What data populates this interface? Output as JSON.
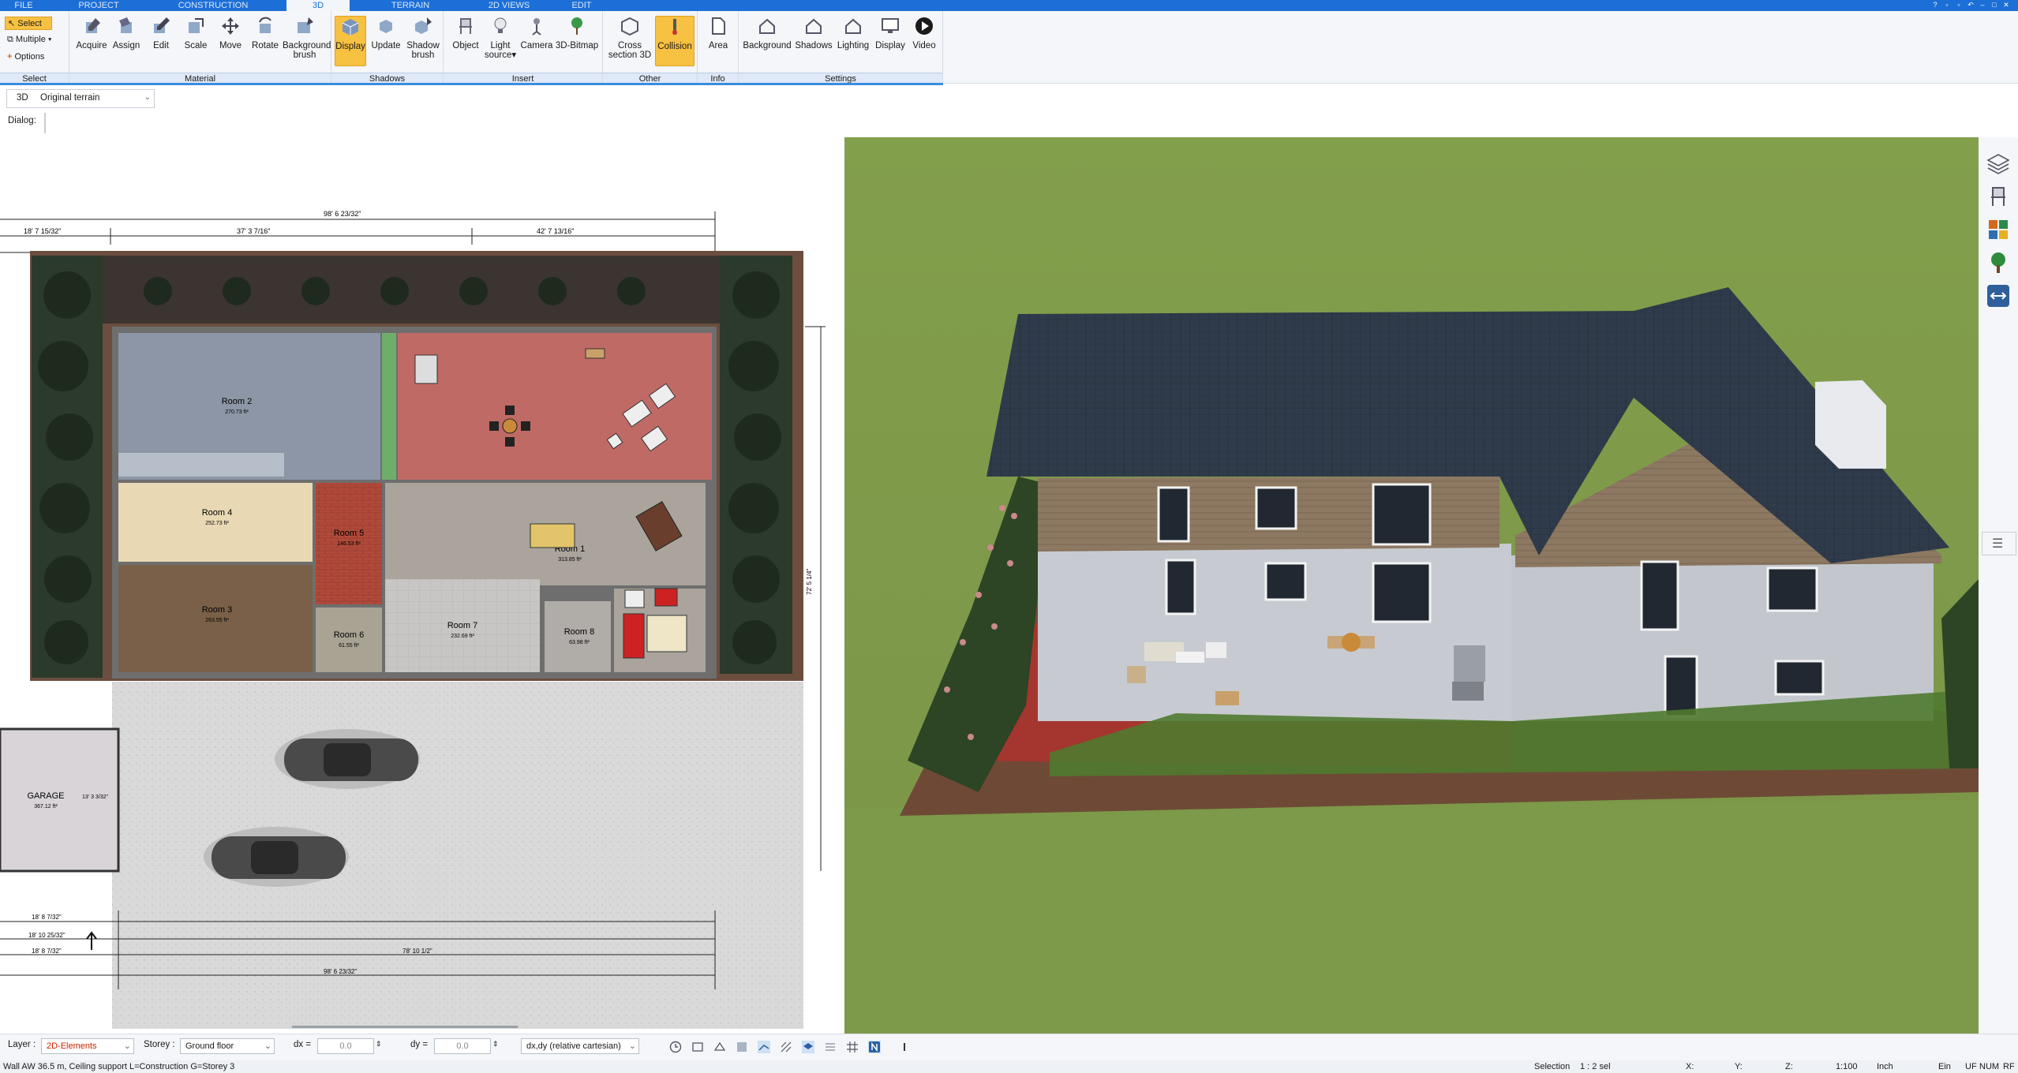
{
  "menu": {
    "tabs": [
      {
        "label": "FILE"
      },
      {
        "label": "PROJECT"
      },
      {
        "label": "CONSTRUCTION"
      },
      {
        "label": "3D"
      },
      {
        "label": "TERRAIN"
      },
      {
        "label": "2D VIEWS"
      },
      {
        "label": "EDIT"
      }
    ],
    "active": "3D"
  },
  "ribbon": {
    "select": {
      "select_label": "Select",
      "multiple_label": "Multiple",
      "options_label": "Options",
      "group": "Select"
    },
    "material": {
      "group": "Material",
      "buttons": [
        "Acquire",
        "Assign",
        "Edit",
        "Scale",
        "Move",
        "Rotate",
        "Background",
        "brush"
      ]
    },
    "shadows": {
      "group": "Shadows",
      "buttons": [
        "Display",
        "Update",
        "Shadow",
        "brush"
      ]
    },
    "insert": {
      "group": "Insert",
      "buttons": [
        "Object",
        "Light",
        "source",
        "Camera",
        "3D-Bitmap"
      ]
    },
    "other": {
      "group": "Other",
      "buttons": [
        "Cross",
        "section 3D",
        "Collision"
      ]
    },
    "info": {
      "group": "Info",
      "buttons": [
        "Area"
      ]
    },
    "settings": {
      "group": "Settings",
      "buttons": [
        "Background",
        "Shadows",
        "Lighting",
        "Display",
        "Video"
      ]
    }
  },
  "viewbar": {
    "view_label": "3D",
    "view_value": "Original terrain",
    "dialog_label": "Dialog:"
  },
  "plan": {
    "rooms": [
      {
        "name": "Room 2",
        "area": "270.73 ft²"
      },
      {
        "name": "Room 4",
        "area": "252.73 ft²"
      },
      {
        "name": "Room 3",
        "area": "263.55 ft²"
      },
      {
        "name": "Room 5",
        "area": "146.53 ft²"
      },
      {
        "name": "Room 1",
        "area": "313.85 ft²"
      },
      {
        "name": "Room 6",
        "area": "61.55 ft²"
      },
      {
        "name": "Room 7",
        "area": "232.69 ft²"
      },
      {
        "name": "Room 8",
        "area": "63.98 ft²"
      },
      {
        "name": "GARAGE",
        "area": "367.12 ft²"
      }
    ],
    "dimensions": {
      "top_total": "98' 6 23/32\"",
      "left_seg": "18' 7 15/32\"",
      "mid_seg": "37' 3 7/16\"",
      "right_seg": "42' 7 13/16\"",
      "bottom_total": "98' 6 23/32\"",
      "bottom_mid": "78' 10 1/2\"",
      "bottom_left1": "18' 8 7/32\"",
      "bottom_left2": "18' 10 25/32\"",
      "bottom_left3": "18' 8 7/32\"",
      "right_vert": "72' 5 1/4\"",
      "garage_dim": "13' 3 3/32\""
    }
  },
  "bottombar": {
    "layer_label": "Layer :",
    "layer_value": "2D-Elements",
    "storey_label": "Storey :",
    "storey_value": "Ground floor",
    "dx_label": "dx =",
    "dx_value": "0.0",
    "dy_label": "dy =",
    "dy_value": "0.0",
    "mode_value": "dx,dy (relative cartesian)"
  },
  "statusbar": {
    "message": "Wall AW 36.5 m, Ceiling support L=Construction G=Storey 3",
    "selection_label": "Selection",
    "selection_value": "1 : 2 sel",
    "x_label": "X:",
    "y_label": "Y:",
    "z_label": "Z:",
    "scale": "1:100",
    "unit": "Inch",
    "ein": "Ein",
    "uf": "UF",
    "num": "NUM",
    "rf": "RF"
  },
  "colors": {
    "accent": "#1c6fd6",
    "active_button": "#f7c142",
    "layer_value": "#cc2200",
    "roof": "#2e3a48",
    "grass": "#7f9e4c"
  },
  "icons": [
    "layers-icon",
    "chair-icon",
    "materials-icon",
    "tree-icon",
    "view-toggle-icon",
    "menu-icon",
    "clock-icon"
  ]
}
